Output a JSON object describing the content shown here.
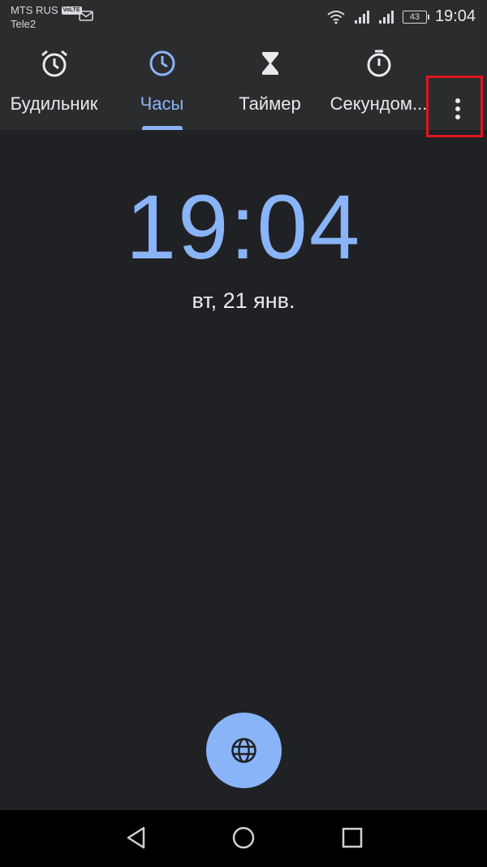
{
  "status_bar": {
    "carrier1": "MTS RUS",
    "network_badge": "VoLTE",
    "carrier2": "Tele2",
    "battery": "43",
    "time": "19:04"
  },
  "tabs": [
    {
      "label": "Будильник",
      "icon": "alarm-icon",
      "active": false
    },
    {
      "label": "Часы",
      "icon": "clock-icon",
      "active": true
    },
    {
      "label": "Таймер",
      "icon": "hourglass-icon",
      "active": false
    },
    {
      "label": "Секундом...",
      "icon": "stopwatch-icon",
      "active": false
    }
  ],
  "more_menu": {
    "icon": "more-vert-icon"
  },
  "clock": {
    "time": "19:04",
    "date": "вт, 21 янв."
  },
  "fab": {
    "icon": "globe-icon"
  },
  "nav": {
    "back": "back-icon",
    "home": "home-icon",
    "recents": "recents-icon"
  },
  "colors": {
    "accent": "#8ab4f8",
    "background": "#202124",
    "highlight": "#e0141e"
  }
}
